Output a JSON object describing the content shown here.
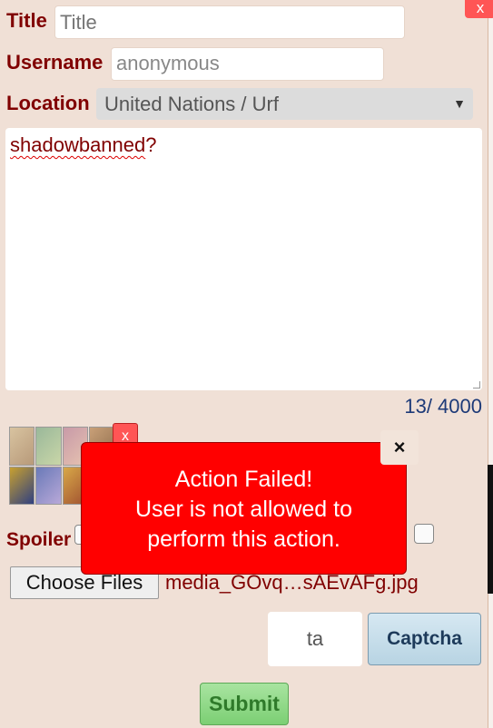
{
  "form": {
    "title_label": "Title",
    "title_placeholder": "Title",
    "username_label": "Username",
    "username_value": "anonymous",
    "location_label": "Location",
    "location_value": "United Nations / Urf",
    "message_word": "shadowbanned",
    "message_rest": "?",
    "char_counter": "13/ 4000",
    "spoiler_label": "Spoiler",
    "choose_files_label": "Choose Files",
    "file_name": "media_GOvq…sAEvAFg.jpg",
    "captcha_value": "ta",
    "captcha_button": "Captcha",
    "submit_label": "Submit"
  },
  "thumbnail_remove_label": "x",
  "panel_close_label": "x",
  "toast": {
    "title": "Action Failed!",
    "line1": "User is not allowed to",
    "line2": "perform this action.",
    "close_glyph": "×"
  },
  "colors": {
    "page_bg": "#f0e0d6",
    "label": "#800000",
    "error": "#ff0000",
    "counter": "#1d3a78"
  }
}
